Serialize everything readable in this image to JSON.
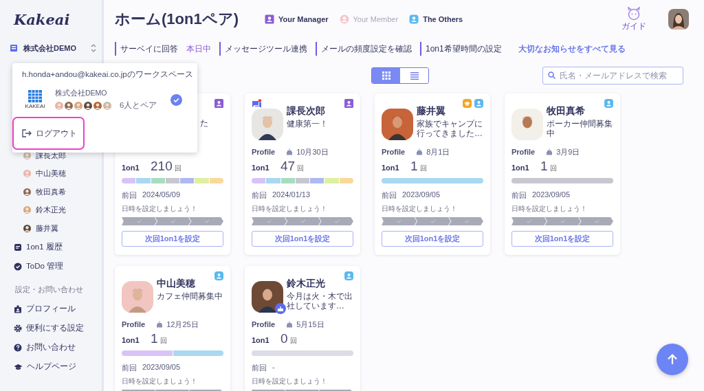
{
  "sidebar": {
    "logo": "Kakeai",
    "workspace": "株式会社DEMO",
    "members": [
      {
        "name": "課長太郎"
      },
      {
        "name": "中山美穂"
      },
      {
        "name": "牧田真希"
      },
      {
        "name": "鈴木正光"
      },
      {
        "name": "藤井翼"
      }
    ],
    "nav": [
      {
        "kind": "history",
        "label": "1on1 履歴"
      },
      {
        "kind": "todo",
        "label": "ToDo 管理"
      }
    ],
    "section_title": "設定・お問い合わせ",
    "settings": [
      {
        "kind": "profile",
        "label": "プロフィール"
      },
      {
        "kind": "gear",
        "label": "便利にする設定"
      },
      {
        "kind": "help",
        "label": "お問い合わせ"
      },
      {
        "kind": "cap",
        "label": "ヘルプページ"
      }
    ]
  },
  "header": {
    "title": "ホーム(1on1ペア)",
    "legend": [
      {
        "kind": "manager",
        "label": "Your Manager",
        "disabled": false
      },
      {
        "kind": "member",
        "label": "Your Member",
        "disabled": true
      },
      {
        "kind": "other",
        "label": "The Others",
        "disabled": false
      }
    ],
    "guide": "ガイド"
  },
  "notices": [
    {
      "label": "サーベイに回答",
      "due": "本日中"
    },
    {
      "label": "メッセージツール連携"
    },
    {
      "label": "メールの頻度設定を確認"
    },
    {
      "label": "1on1希望時間の設定"
    }
  ],
  "notices_link": "大切なお知らせをすべて見る",
  "view_toggle": [
    {
      "kind": "grid",
      "selected": true
    },
    {
      "kind": "list",
      "selected": false
    }
  ],
  "search": {
    "placeholder": "氏名・メールアドレスで検索"
  },
  "cards": [
    {
      "roles": [
        {
          "kind": "manager"
        }
      ],
      "bio": "た",
      "count_label": "1on1",
      "count": "210",
      "count_unit": "回",
      "last_label": "前回",
      "last": "2024/05/09",
      "prompt": "日時を設定しましょう！",
      "button": "次回1on1を設定",
      "segments": [
        {
          "color": "#d9c2f7"
        },
        {
          "color": "#a9d8f0"
        },
        {
          "color": "#a8dcc1"
        },
        {
          "color": "#c7c8cf"
        },
        {
          "color": "#aeb9f2"
        },
        {
          "color": "#dff0a0"
        },
        {
          "color": "#f9d99a"
        }
      ]
    },
    {
      "roles": [
        {
          "kind": "manager"
        }
      ],
      "chat": true,
      "name": "課長次郎",
      "bio": "健康第一！",
      "profile_label": "Profile",
      "birthday": "10月30日",
      "count_label": "1on1",
      "count": "47",
      "count_unit": "回",
      "last_label": "前回",
      "last": "2024/01/13",
      "prompt": "日時を設定しましょう！",
      "button": "次回1on1を設定",
      "segments": [
        {
          "color": "#d9c2f7"
        },
        {
          "color": "#a9d8f0"
        },
        {
          "color": "#a8dcc1"
        },
        {
          "color": "#c7c8cf"
        },
        {
          "color": "#aeb9f2"
        },
        {
          "color": "#dff0a0"
        },
        {
          "color": "#f9d99a"
        }
      ]
    },
    {
      "roles": [
        {
          "kind": "mentor"
        },
        {
          "kind": "other"
        }
      ],
      "name": "藤井翼",
      "bio": "家族でキャンプに行ってきました…",
      "profile_label": "Profile",
      "birthday": "8月1日",
      "count_label": "1on1",
      "count": "1",
      "count_unit": "回",
      "last_label": "前回",
      "last": "2023/09/05",
      "prompt": "日時を設定しましょう！",
      "button": "次回1on1を設定",
      "segments": [
        {
          "color": "#a9d8f0"
        }
      ]
    },
    {
      "roles": [
        {
          "kind": "other"
        }
      ],
      "name": "牧田真希",
      "bio": "ポーカー仲間募集中",
      "profile_label": "Profile",
      "birthday": "3月9日",
      "count_label": "1on1",
      "count": "1",
      "count_unit": "回",
      "last_label": "前回",
      "last": "2023/09/05",
      "prompt": "日時を設定しましょう！",
      "button": "次回1on1を設定",
      "segments": [
        {
          "color": "#c7c8cf"
        }
      ]
    },
    {
      "roles": [
        {
          "kind": "other"
        }
      ],
      "name": "中山美穂",
      "bio": "カフェ仲間募集中",
      "profile_label": "Profile",
      "birthday": "12月25日",
      "count_label": "1on1",
      "count": "1",
      "count_unit": "回",
      "last_label": "前回",
      "last": "2023/09/05",
      "prompt": "日時を設定しましょう！",
      "segments": [
        {
          "color": "#d9c2f7"
        },
        {
          "color": "#a9d8f0"
        }
      ]
    },
    {
      "roles": [
        {
          "kind": "other"
        }
      ],
      "birthday_badge": true,
      "name": "鈴木正光",
      "bio": "今月は火・木で出社しています…",
      "profile_label": "Profile",
      "birthday": "5月15日",
      "count_label": "1on1",
      "count": "0",
      "count_unit": "回",
      "last_label": "前回",
      "last": "-",
      "prompt": "日時を設定しましょう！",
      "segments": [
        {
          "color": "#dcdce6"
        }
      ]
    }
  ],
  "popup": {
    "email_line": "h.honda+andou@kakeai.co.jpのワークスペース",
    "logo_text": "KAKEAI",
    "workspace": "株式会社DEMO",
    "pair_count": "6人とペア",
    "selected": true,
    "logout": "ログアウト"
  }
}
